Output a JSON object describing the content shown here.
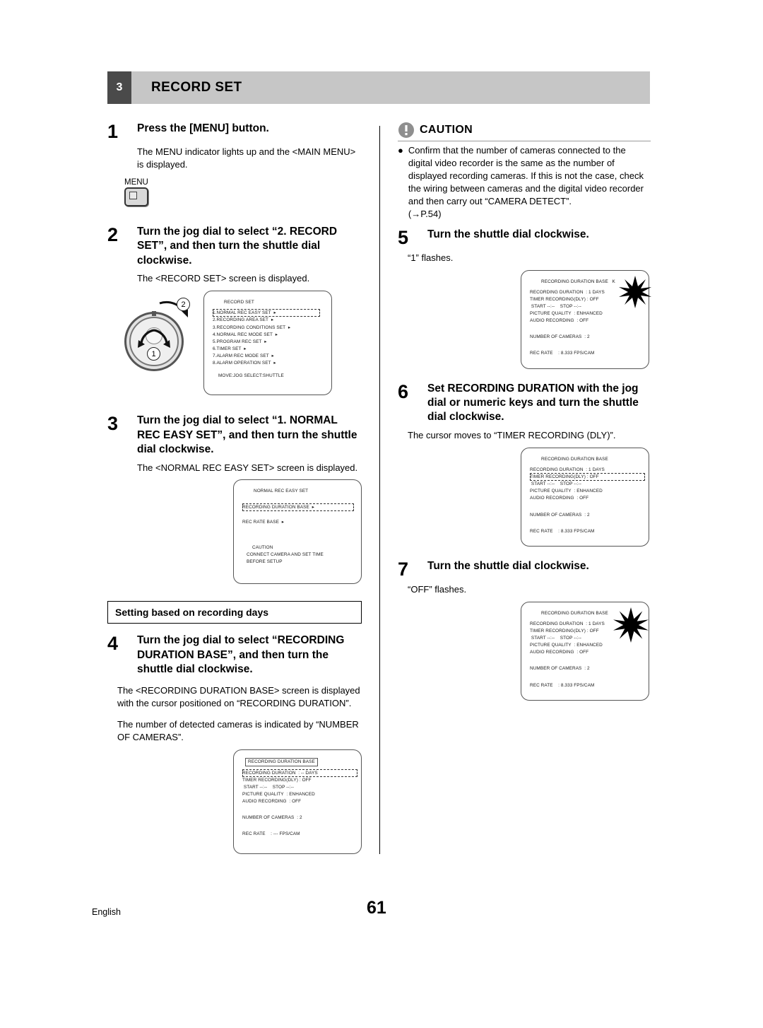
{
  "chapter": {
    "number": "3",
    "title": "RECORD SET"
  },
  "footer": {
    "language": "English",
    "page": "61"
  },
  "left_column": {
    "step1": {
      "number": "1",
      "heading": "Press the [MENU] button.",
      "body": "The MENU indicator lights up and the <MAIN MENU> is displayed.",
      "menu_button_label": "MENU"
    },
    "step2": {
      "number": "2",
      "heading": "Turn the jog dial to select “2. RECORD SET”, and then turn the shuttle dial clockwise.",
      "body": "The <RECORD SET> screen is displayed.",
      "dial_badge_1": "1",
      "dial_badge_2": "2"
    },
    "step3": {
      "number": "3",
      "heading": "Turn the jog dial to select “1. NORMAL REC EASY SET”, and then turn the shuttle dial clockwise.",
      "body": "The <NORMAL REC EASY SET> screen is displayed."
    },
    "section_label": "Setting based on recording days",
    "step4": {
      "number": "4",
      "heading": "Turn the jog dial to select “RECORDING DURATION BASE”, and then turn the shuttle dial clockwise.",
      "body1": "The <RECORDING DURATION BASE> screen is displayed with the cursor positioned on “RECORDING DURATION”.",
      "body2": "The number of detected cameras is indicated by “NUMBER OF CAMERAS”."
    }
  },
  "right_column": {
    "caution": {
      "label": "CAUTION",
      "bullet": "Confirm that the number of cameras connected to the digital video recorder is the same as the number of displayed recording cameras. If this is not the case, check the wiring between cameras and the digital video recorder and then carry out “CAMERA DETECT”.",
      "page_ref": "(→P.54)"
    },
    "step5": {
      "number": "5",
      "heading": "Turn the shuttle dial clockwise.",
      "body": "“1” flashes."
    },
    "step6": {
      "number": "6",
      "heading": "Set RECORDING DURATION with the jog dial or numeric keys and turn the shuttle dial clockwise.",
      "body": "The cursor moves to “TIMER RECORDING (DLY)”."
    },
    "step7": {
      "number": "7",
      "heading": "Turn the shuttle dial clockwise.",
      "body": "“OFF” flashes."
    }
  },
  "osd_record_set": {
    "title": "RECORD SET",
    "items": [
      "1.NORMAL REC EASY SET",
      "2.RECORDING AREA SET",
      "3.RECORDING CONDITIONS SET",
      "4.NORMAL REC MODE SET",
      "5.PROGRAM REC SET",
      "6.TIMER SET",
      "7.ALARM REC MODE SET",
      "8.ALARM OPERATION SET"
    ],
    "footer": "MOVE:JOG    SELECT:SHUTTLE",
    "selected_index": 0
  },
  "osd_normal_rec_easy_set": {
    "title": "NORMAL REC EASY SET",
    "row1_label": "RECORDING DURATION BASE",
    "row2_label": "REC RATE BASE",
    "caution_title": "CAUTION",
    "caution_line1": "CONNECT CAMERA AND SET TIME",
    "caution_line2": "BEFORE SETUP"
  },
  "osd_duration_base_blank": {
    "title": "RECORDING DURATION BASE",
    "rows": [
      {
        "label": "RECORDING DURATION",
        "value": ": -- DAYS",
        "highlight": true
      },
      {
        "label": "TIMER RECORDING(DLY)",
        "value": ": OFF",
        "highlight": false
      },
      {
        "label": " START --:--    STOP --:--",
        "value": "",
        "highlight": false
      },
      {
        "label": "PICTURE QUALITY",
        "value": ": ENHANCED",
        "highlight": false
      },
      {
        "label": "AUDIO RECORDING",
        "value": ": OFF",
        "highlight": false
      }
    ],
    "cameras_label": "NUMBER OF CAMERAS",
    "cameras_value": ": 2",
    "rate_label": "REC RATE",
    "rate_value": ": --- FPS/CAM"
  },
  "osd_step5": {
    "title": "RECORDING DURATION BASE",
    "flash_marker": "K",
    "rows": [
      {
        "label": "RECORDING DURATION",
        "value": ": 1 DAYS"
      },
      {
        "label": "TIMER RECORDING(DLY)",
        "value": ": OFF"
      },
      {
        "label": " START --:--    STOP --:--",
        "value": ""
      },
      {
        "label": "PICTURE QUALITY",
        "value": ": ENHANCED"
      },
      {
        "label": "AUDIO RECORDING",
        "value": ": OFF"
      }
    ],
    "cameras_label": "NUMBER OF CAMERAS",
    "cameras_value": ": 2",
    "rate_label": "REC RATE",
    "rate_value": ": 8.333 FPS/CAM"
  },
  "osd_step6": {
    "title": "RECORDING DURATION BASE",
    "rows": [
      {
        "label": "RECORDING DURATION",
        "value": ": 1 DAYS",
        "highlight": false
      },
      {
        "label": "TIMER RECORDING(DLY)",
        "value": ": OFF",
        "highlight": true
      },
      {
        "label": " START --:--    STOP --:--",
        "value": "",
        "highlight": false
      },
      {
        "label": "PICTURE QUALITY",
        "value": ": ENHANCED",
        "highlight": false
      },
      {
        "label": "AUDIO RECORDING",
        "value": ": OFF",
        "highlight": false
      }
    ],
    "cameras_label": "NUMBER OF CAMERAS",
    "cameras_value": ": 2",
    "rate_label": "REC RATE",
    "rate_value": ": 8.333 FPS/CAM"
  },
  "osd_step7": {
    "title": "RECORDING DURATION BASE",
    "rows": [
      {
        "label": "RECORDING DURATION",
        "value": ": 1 DAYS"
      },
      {
        "label": "TIMER RECORDING(DLY)",
        "value": ": OFF"
      },
      {
        "label": " START --:--    STOP --:--",
        "value": ""
      },
      {
        "label": "PICTURE QUALITY",
        "value": ": ENHANCED"
      },
      {
        "label": "AUDIO RECORDING",
        "value": ": OFF"
      }
    ],
    "cameras_label": "NUMBER OF CAMERAS",
    "cameras_value": ": 2",
    "rate_label": "REC RATE",
    "rate_value": ": 8.333 FPS/CAM"
  }
}
